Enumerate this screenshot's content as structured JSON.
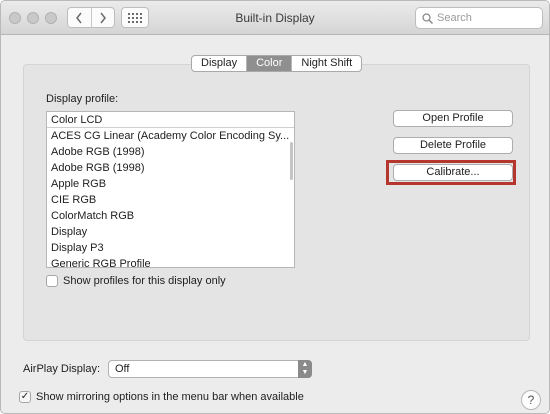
{
  "window": {
    "title": "Built-in Display"
  },
  "search": {
    "placeholder": "Search"
  },
  "tabs": [
    {
      "label": "Display",
      "active": false
    },
    {
      "label": "Color",
      "active": true
    },
    {
      "label": "Night Shift",
      "active": false
    }
  ],
  "profile": {
    "label": "Display profile:",
    "selected": "Color LCD",
    "items": [
      "ACES CG Linear (Academy Color Encoding Sy...",
      "Adobe RGB (1998)",
      "Adobe RGB (1998)",
      "Apple RGB",
      "CIE RGB",
      "ColorMatch RGB",
      "Display",
      "Display P3",
      "Generic RGB Profile"
    ],
    "show_only_label": "Show profiles for this display only",
    "show_only_checked": false
  },
  "buttons": {
    "open": "Open Profile",
    "delete": "Delete Profile",
    "calibrate": "Calibrate..."
  },
  "airplay": {
    "label": "AirPlay Display:",
    "value": "Off"
  },
  "mirroring": {
    "label": "Show mirroring options in the menu bar when available",
    "checked": true
  },
  "help": {
    "label": "?"
  },
  "colors": {
    "highlight": "#b5362c",
    "active_tab": "#8f8f8f"
  }
}
